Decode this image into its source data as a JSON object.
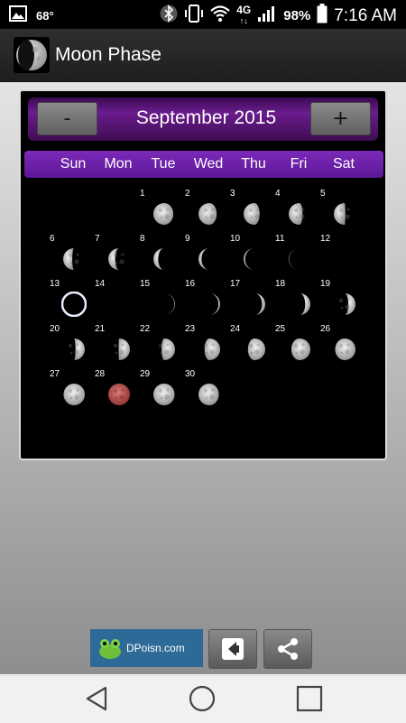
{
  "status_bar": {
    "temperature": "68°",
    "network": "4G",
    "battery": "98%",
    "time": "7:16 AM"
  },
  "app_bar": {
    "title": "Moon Phase"
  },
  "calendar": {
    "month_title": "September 2015",
    "prev_label": "-",
    "next_label": "+",
    "weekdays": [
      "Sun",
      "Mon",
      "Tue",
      "Wed",
      "Thu",
      "Fri",
      "Sat"
    ],
    "first_weekday_index": 2,
    "days": [
      {
        "day": "1",
        "phase": "waning-gibbous",
        "illumination": 0.92
      },
      {
        "day": "2",
        "phase": "waning-gibbous",
        "illumination": 0.84
      },
      {
        "day": "3",
        "phase": "waning-gibbous",
        "illumination": 0.74
      },
      {
        "day": "4",
        "phase": "waning-gibbous",
        "illumination": 0.64
      },
      {
        "day": "5",
        "phase": "third-quarter",
        "illumination": 0.53
      },
      {
        "day": "6",
        "phase": "waning-crescent",
        "illumination": 0.42
      },
      {
        "day": "7",
        "phase": "waning-crescent",
        "illumination": 0.32
      },
      {
        "day": "8",
        "phase": "waning-crescent",
        "illumination": 0.22
      },
      {
        "day": "9",
        "phase": "waning-crescent",
        "illumination": 0.14
      },
      {
        "day": "10",
        "phase": "waning-crescent",
        "illumination": 0.07
      },
      {
        "day": "11",
        "phase": "waning-crescent",
        "illumination": 0.02
      },
      {
        "day": "12",
        "phase": "new-moon",
        "illumination": 0.0
      },
      {
        "day": "13",
        "phase": "solar-eclipse",
        "illumination": 0.0
      },
      {
        "day": "14",
        "phase": "new-moon",
        "illumination": 0.0
      },
      {
        "day": "15",
        "phase": "waxing-crescent",
        "illumination": 0.03
      },
      {
        "day": "16",
        "phase": "waxing-crescent",
        "illumination": 0.08
      },
      {
        "day": "17",
        "phase": "waxing-crescent",
        "illumination": 0.15
      },
      {
        "day": "18",
        "phase": "waxing-crescent",
        "illumination": 0.24
      },
      {
        "day": "19",
        "phase": "waxing-crescent",
        "illumination": 0.33
      },
      {
        "day": "20",
        "phase": "waxing-crescent",
        "illumination": 0.43
      },
      {
        "day": "21",
        "phase": "first-quarter",
        "illumination": 0.52
      },
      {
        "day": "22",
        "phase": "waxing-gibbous",
        "illumination": 0.62
      },
      {
        "day": "23",
        "phase": "waxing-gibbous",
        "illumination": 0.72
      },
      {
        "day": "24",
        "phase": "waxing-gibbous",
        "illumination": 0.8
      },
      {
        "day": "25",
        "phase": "waxing-gibbous",
        "illumination": 0.88
      },
      {
        "day": "26",
        "phase": "waxing-gibbous",
        "illumination": 0.94
      },
      {
        "day": "27",
        "phase": "waxing-gibbous",
        "illumination": 0.98
      },
      {
        "day": "28",
        "phase": "lunar-eclipse",
        "illumination": 1.0
      },
      {
        "day": "29",
        "phase": "waning-gibbous",
        "illumination": 0.98
      },
      {
        "day": "30",
        "phase": "waning-gibbous",
        "illumination": 0.94
      }
    ]
  },
  "ad": {
    "text": "DPoisn.com"
  },
  "icons": {
    "gallery": "gallery-notification-icon",
    "bluetooth": "bluetooth-icon",
    "vibrate": "vibrate-icon",
    "wifi": "wifi-icon",
    "signal": "signal-icon",
    "battery": "battery-icon",
    "back": "back-arrow-icon",
    "share": "share-icon",
    "nav_back": "nav-back-icon",
    "nav_home": "nav-home-icon",
    "nav_recents": "nav-recents-icon"
  },
  "colors": {
    "calendar_header": "#5a1a7a",
    "weekday_bar": "#6d22a8",
    "lunar_eclipse": "#b84a4a"
  }
}
